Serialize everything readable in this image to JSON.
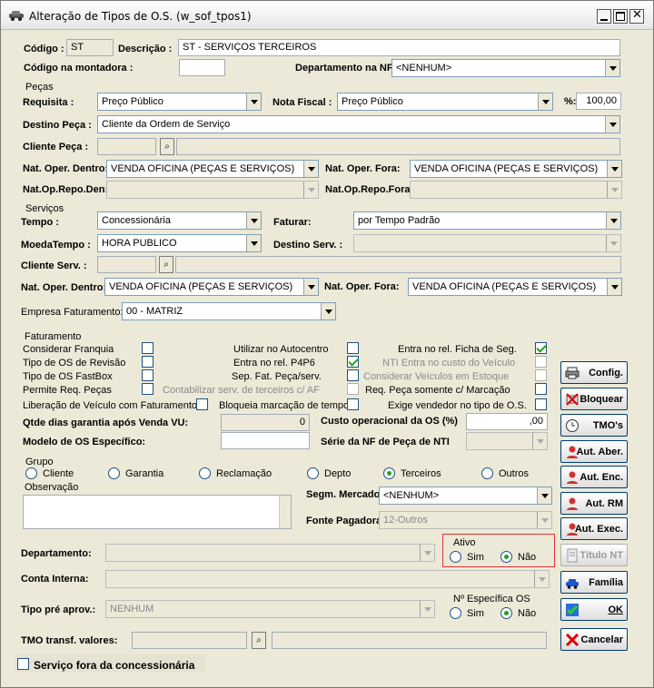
{
  "window": {
    "title": "Alteração de Tipos de O.S. (w_sof_tpos1)"
  },
  "header": {
    "codigo_label": "Código :",
    "codigo_value": "ST",
    "descricao_label": "Descrição :",
    "descricao_value": "ST - SERVIÇOS TERCEIROS",
    "cod_montadora_label": "Código na montadora :",
    "depto_nf_label": "Departamento na NF:",
    "depto_nf_value": "<NENHUM>"
  },
  "pecas": {
    "group": "Peças",
    "requisita_label": "Requisita :",
    "requisita_value": "Preço Público",
    "nota_label": "Nota Fiscal :",
    "nota_value": "Preço Público",
    "pct_label": "%:",
    "pct_value": "100,00",
    "destino_label": "Destino Peça :",
    "destino_value": "Cliente da Ordem de Serviço",
    "cliente_label": "Cliente Peça :",
    "nat_dentro_label": "Nat. Oper. Dentro:",
    "nat_dentro_value": "VENDA OFICINA (PEÇAS E SERVIÇOS)",
    "nat_fora_label": "Nat. Oper. Fora:",
    "nat_fora_value": "VENDA OFICINA (PEÇAS E SERVIÇOS)",
    "repo_den_label": "Nat.Op.Repo.Den:",
    "repo_fora_label": "Nat.Op.Repo.Fora:"
  },
  "servicos": {
    "group": "Serviços",
    "tempo_label": "Tempo :",
    "tempo_value": "Concessionária",
    "faturar_label": "Faturar:",
    "faturar_value": "por Tempo Padrão",
    "moeda_label": "MoedaTempo :",
    "moeda_value": "HORA PUBLICO",
    "destino_label": "Destino Serv. :",
    "cliente_label": "Cliente Serv. :",
    "nat_dentro_label": "Nat. Oper. Dentro:",
    "nat_dentro_value": "VENDA OFICINA (PEÇAS E SERVIÇOS)",
    "nat_fora_label": "Nat. Oper. Fora:",
    "nat_fora_value": "VENDA OFICINA (PEÇAS E SERVIÇOS)",
    "empresa_label": "Empresa Faturamento:",
    "empresa_value": "00 - MATRIZ"
  },
  "faturamento": {
    "group": "Faturamento",
    "franquia": "Considerar Franquia",
    "revisao": "Tipo de OS de Revisão",
    "fastbox": "Tipo de OS FastBox",
    "req_pecas": "Permite Req. Peças",
    "liberacao": "Liberação de Veículo com Faturamento",
    "autocentro": "Utilizar no Autocentro",
    "p4p6": "Entra no rel. P4P6",
    "sep_fat": "Sep. Fat. Peça/serv.",
    "contab": "Contabilizar serv. de terceiros c/ AF",
    "bloqueia": "Bloqueia marcação de tempo",
    "ficha": "Entra no rel. Ficha de Seg.",
    "nti_custo": "NTI Entra no custo do Veículo",
    "estoque": "Considerar Veículos em Estoque",
    "req_marcacao": "Req. Peça somente c/ Marcação",
    "exige_vend": "Exige vendedor no tipo de O.S.",
    "garantia_label": "Qtde dias garantia após Venda VU:",
    "garantia_value": "0",
    "custo_label": "Custo operacional da OS (%)",
    "custo_value": ",00",
    "modelo_label": "Modelo de OS Específico:",
    "serie_label": "Série da NF de Peça de NTI"
  },
  "grupo": {
    "group": "Grupo",
    "opts": [
      "Cliente",
      "Garantia",
      "Reclamação",
      "Depto",
      "Terceiros",
      "Outros"
    ],
    "selected": "Terceiros"
  },
  "obs": {
    "label": "Observação",
    "segm_label": "Segm. Mercado:",
    "segm_value": "<NENHUM>",
    "fonte_label": "Fonte Pagadora:",
    "fonte_value": "12-Outros"
  },
  "bottom": {
    "depto_label": "Departamento:",
    "conta_label": "Conta Interna:",
    "tipo_pre_label": "Tipo pré aprov.:",
    "tipo_pre_value": "NENHUM",
    "tmo_label": "TMO transf. valores:",
    "servico_fora": "Serviço fora da concessionária"
  },
  "ativo": {
    "label": "Ativo",
    "sim": "Sim",
    "nao": "Não",
    "value": "Não"
  },
  "nesp": {
    "label": "Nº Específica OS",
    "sim": "Sim",
    "nao": "Não",
    "value": "Não"
  },
  "buttons": {
    "config": "Config.",
    "bloquear": "Bloquear",
    "tmos": "TMO's",
    "aut_aber": "Aut. Aber.",
    "aut_enc": "Aut. Enc.",
    "aut_rm": "Aut. RM",
    "aut_exec": "Aut. Exec.",
    "titulo_nt": "Título NT",
    "familia": "Família",
    "ok": "OK",
    "cancelar": "Cancelar"
  },
  "colors": {
    "accent": "#21a121",
    "border": "#003c74",
    "highlight": "#e03030"
  }
}
